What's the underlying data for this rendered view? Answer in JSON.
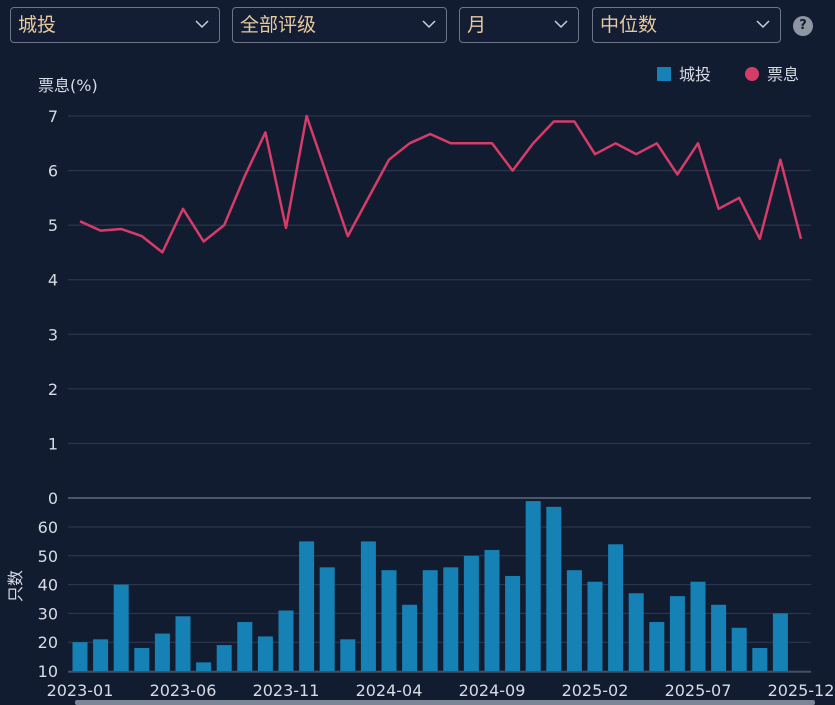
{
  "toolbar": {
    "filters": [
      {
        "value": "城投"
      },
      {
        "value": "全部评级"
      },
      {
        "value": "月"
      },
      {
        "value": "中位数"
      }
    ],
    "help": "?"
  },
  "colors": {
    "bar": "#1681b5",
    "line": "#d63c68",
    "background": "#121c31"
  },
  "chart_data": {
    "type": "bar+line",
    "categories": [
      "2023-01",
      "2023-02",
      "2023-03",
      "2023-04",
      "2023-05",
      "2023-06",
      "2023-07",
      "2023-08",
      "2023-09",
      "2023-10",
      "2023-11",
      "2023-12",
      "2024-01",
      "2024-02",
      "2024-03",
      "2024-04",
      "2024-05",
      "2024-06",
      "2024-07",
      "2024-08",
      "2024-09",
      "2024-10",
      "2024-11",
      "2024-12",
      "2025-01",
      "2025-02",
      "2025-03",
      "2025-04",
      "2025-05",
      "2025-06",
      "2025-07",
      "2025-08",
      "2025-09",
      "2025-10",
      "2025-11",
      "2025-12"
    ],
    "x_tick_labels": [
      "2023-01",
      "2023-06",
      "2023-11",
      "2024-04",
      "2024-09",
      "2025-02",
      "2025-07",
      "2025-12"
    ],
    "series": [
      {
        "name": "票息",
        "chart": "line",
        "axis": "top",
        "values": [
          5.07,
          4.9,
          4.93,
          4.8,
          4.5,
          5.3,
          4.7,
          5.0,
          5.9,
          6.7,
          4.95,
          7.0,
          5.9,
          4.8,
          5.5,
          6.2,
          6.5,
          6.67,
          6.5,
          6.5,
          6.5,
          6.0,
          6.5,
          6.9,
          6.9,
          6.3,
          6.5,
          6.3,
          6.5,
          5.93,
          6.5,
          5.3,
          5.5,
          4.75,
          6.2,
          4.75
        ]
      },
      {
        "name": "城投",
        "chart": "bar",
        "axis": "bottom",
        "values": [
          20,
          21,
          40,
          18,
          23,
          29,
          13,
          19,
          27,
          22,
          31,
          55,
          46,
          21,
          55,
          45,
          33,
          45,
          46,
          50,
          52,
          43,
          69,
          67,
          45,
          41,
          54,
          37,
          27,
          36,
          41,
          33,
          25,
          18,
          30,
          null
        ]
      }
    ],
    "top_axis": {
      "label": "票息(%)",
      "ticks": [
        0,
        1,
        2,
        3,
        4,
        5,
        6,
        7
      ],
      "ylim": [
        0,
        7.3
      ]
    },
    "bottom_axis": {
      "label": "只数",
      "ticks": [
        10,
        20,
        30,
        40,
        50,
        60
      ],
      "ylim": [
        10,
        70
      ]
    },
    "legend": {
      "position": "top-right"
    },
    "grid": true
  }
}
